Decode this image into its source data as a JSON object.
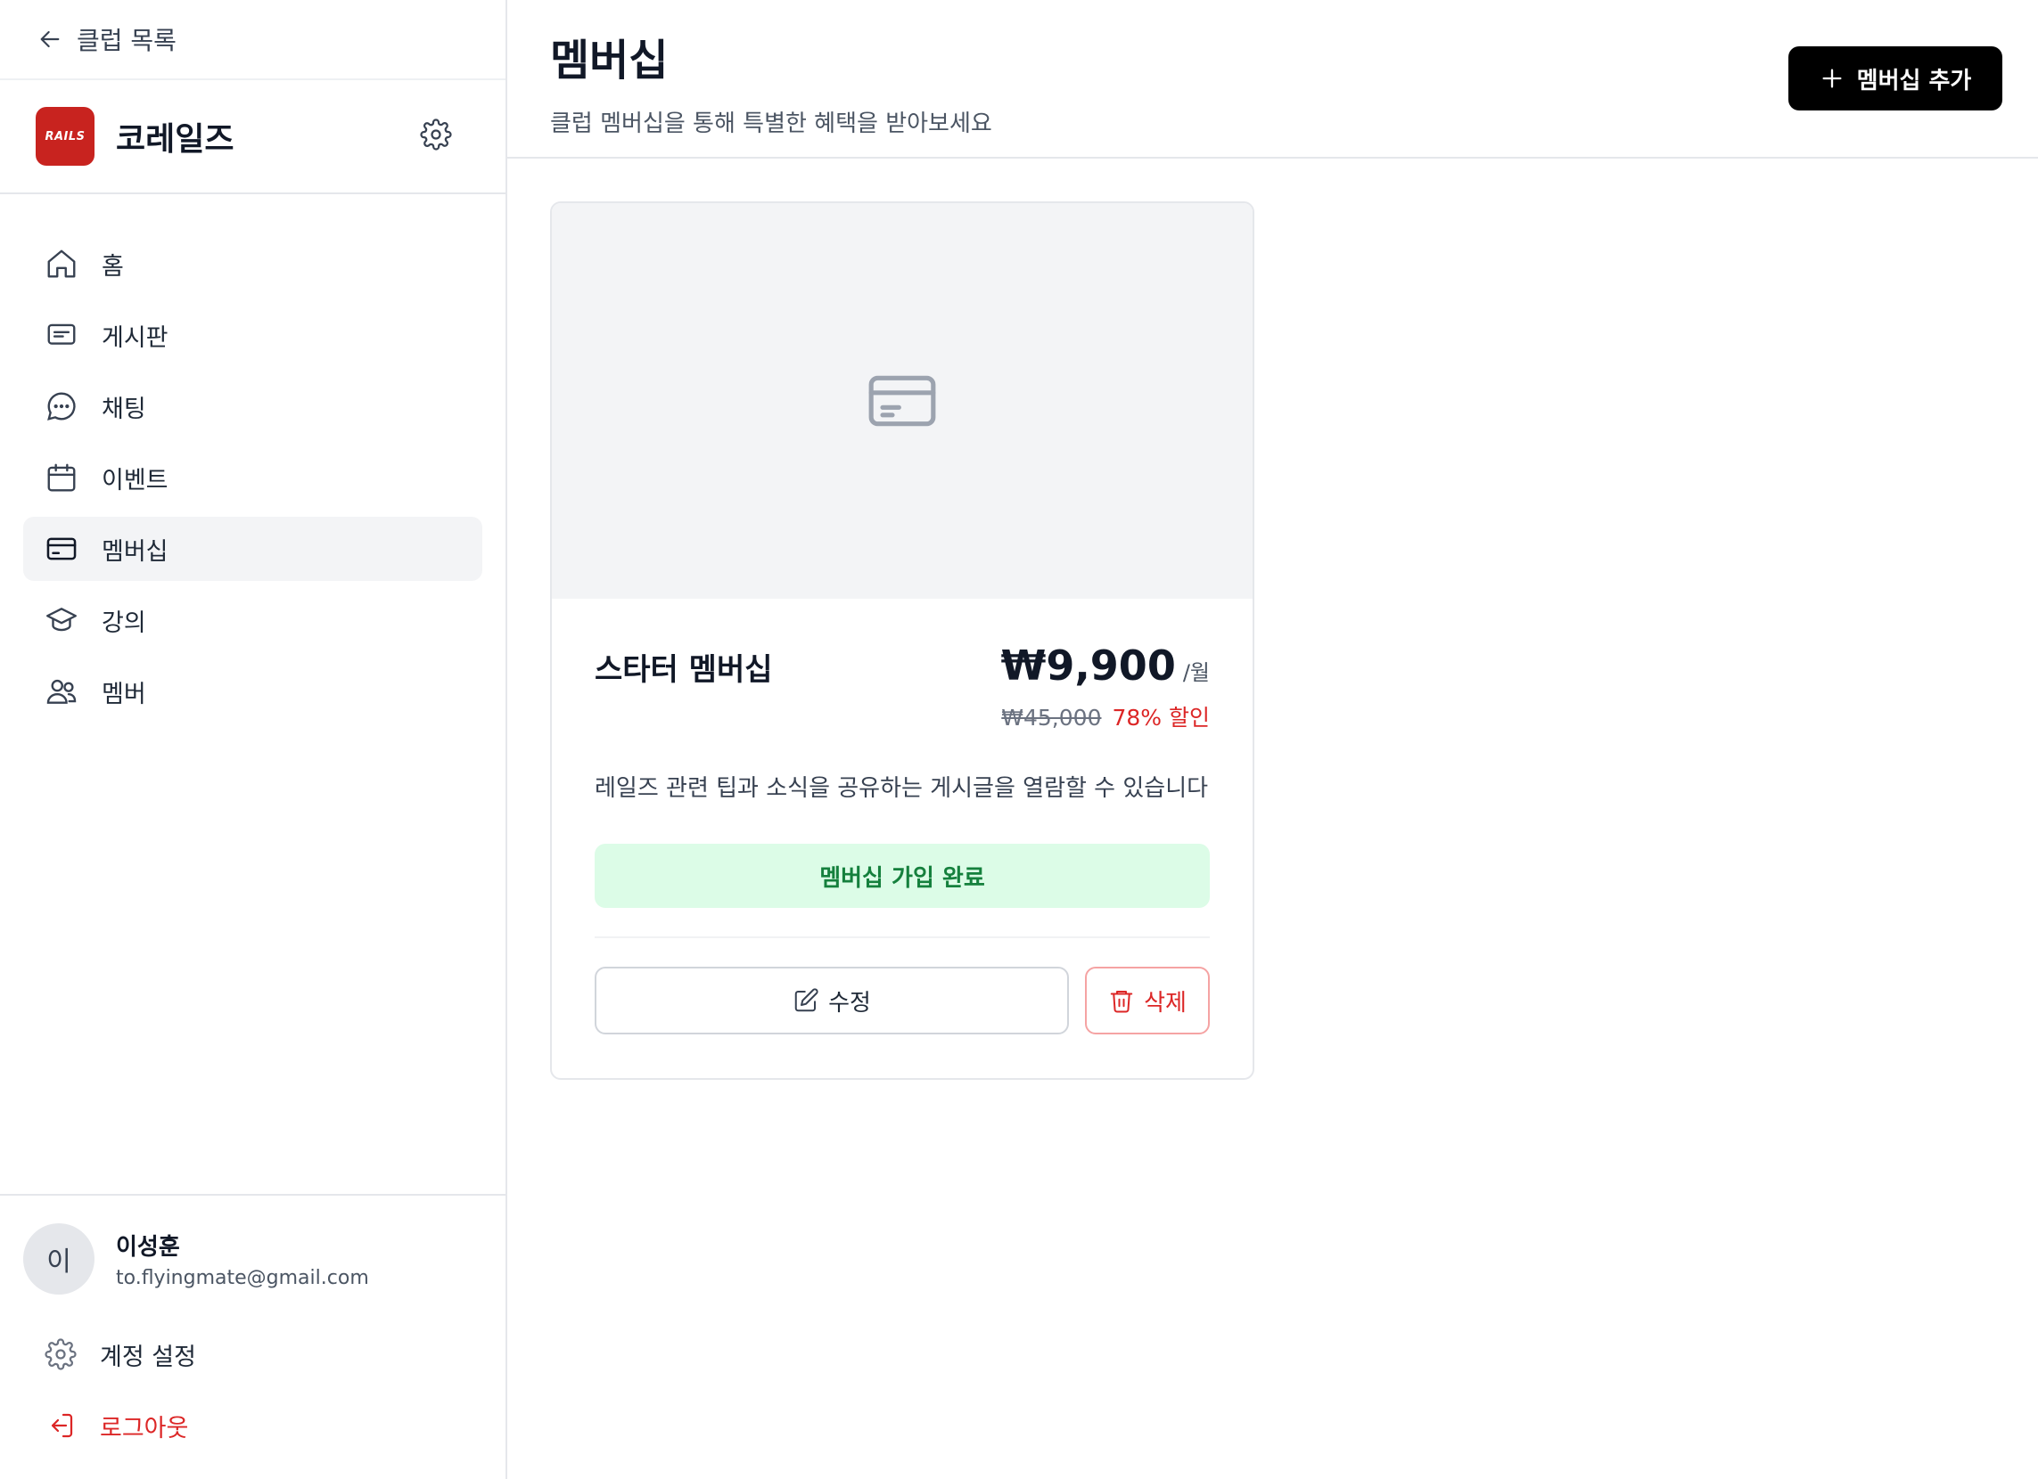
{
  "sidebar": {
    "back_label": "클럽 목록",
    "club": {
      "name": "코레일즈",
      "logo_text": "RAILS",
      "logo_color": "#c8231f"
    },
    "nav": [
      {
        "label": "홈",
        "icon": "home-icon",
        "active": false
      },
      {
        "label": "게시판",
        "icon": "board-icon",
        "active": false
      },
      {
        "label": "채팅",
        "icon": "chat-icon",
        "active": false
      },
      {
        "label": "이벤트",
        "icon": "calendar-icon",
        "active": false
      },
      {
        "label": "멤버십",
        "icon": "credit-card-icon",
        "active": true
      },
      {
        "label": "강의",
        "icon": "graduation-cap-icon",
        "active": false
      },
      {
        "label": "멤버",
        "icon": "users-icon",
        "active": false
      }
    ],
    "user": {
      "avatar_initial": "이",
      "name": "이성훈",
      "email": "to.flyingmate@gmail.com"
    },
    "account_settings_label": "계정 설정",
    "logout_label": "로그아웃"
  },
  "header": {
    "title": "멤버십",
    "subtitle": "클럽 멤버십을 통해 특별한 혜택을 받아보세요",
    "add_button_label": "멤버십 추가"
  },
  "membership_card": {
    "name": "스타터 멤버십",
    "price": "₩9,900",
    "price_unit": "/월",
    "original_price": "₩45,000",
    "discount": "78% 할인",
    "description": "레일즈 관련 팁과 소식을 공유하는 게시글을 열람할 수 있습니다",
    "status": "멤버십 가입 완료",
    "edit_label": "수정",
    "delete_label": "삭제"
  },
  "colors": {
    "accent": "#000000",
    "danger": "#dc2626",
    "success_bg": "#dcfce7",
    "success_text": "#15803d"
  }
}
